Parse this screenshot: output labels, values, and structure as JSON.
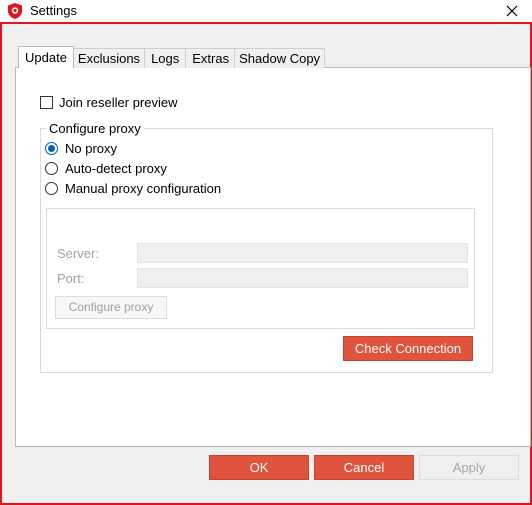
{
  "window": {
    "title": "Settings"
  },
  "tabs": [
    {
      "label": "Update",
      "active": true
    },
    {
      "label": "Exclusions",
      "active": false
    },
    {
      "label": "Logs",
      "active": false
    },
    {
      "label": "Extras",
      "active": false
    },
    {
      "label": "Shadow Copy",
      "active": false
    }
  ],
  "update": {
    "reseller_preview_label": "Join reseller preview",
    "reseller_preview_checked": false,
    "proxy_group_title": "Configure proxy",
    "proxy_options": [
      {
        "label": "No proxy",
        "checked": true
      },
      {
        "label": "Auto-detect proxy",
        "checked": false
      },
      {
        "label": "Manual proxy configuration",
        "checked": false
      }
    ],
    "server_label": "Server:",
    "server_value": "",
    "port_label": "Port:",
    "port_value": "",
    "configure_proxy_button": "Configure proxy",
    "check_connection_button": "Check Connection"
  },
  "footer": {
    "ok": "OK",
    "cancel": "Cancel",
    "apply": "Apply"
  },
  "colors": {
    "accent_red": "#e0533d",
    "frame_red": "#e0151d",
    "radio_blue": "#0063b1"
  }
}
